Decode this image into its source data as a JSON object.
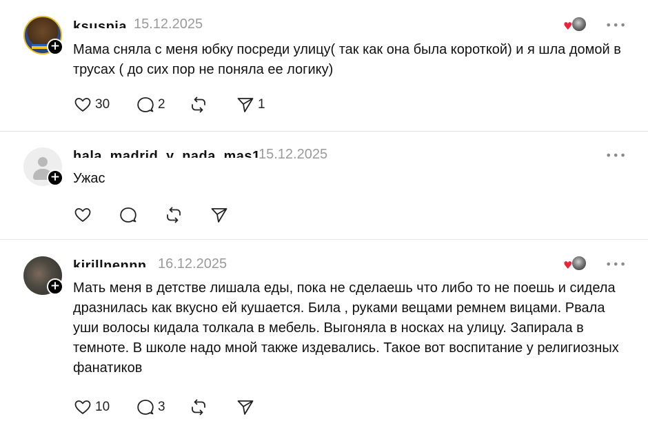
{
  "posts": [
    {
      "username": "ksuspia",
      "date": "15.12.2025",
      "text": "Мама сняла с меня юбку посреди улицу( так как она была короткой) и я шла домой в трусах ( до сих пор не поняла ее логику)",
      "likes": "30",
      "replies": "2",
      "reposts": "",
      "shares": "1"
    },
    {
      "username": "hala_madrid_y_nada_mas1",
      "date": "15.12.2025",
      "text": "Ужас",
      "likes": "",
      "replies": "",
      "reposts": "",
      "shares": ""
    },
    {
      "username": "kirillnennn",
      "date": "16.12.2025",
      "text": "Мать меня в детстве лишала еды, пока не сделаешь что либо то не поешь и сидела дразнилась как вкусно ей кушается. Била , руками вещами ремнем вицами. Рвала уши волосы кидала толкала в мебель. Выгоняла в носках на улицу. Запирала в темноте. В школе надо мной также издевались. Такое вот воспитание у религиозных фанатиков",
      "likes": "10",
      "replies": "3",
      "reposts": "",
      "shares": ""
    }
  ],
  "icons": {
    "more": "more-horizontal-icon",
    "follow": "plus-icon",
    "like": "heart-icon",
    "reply": "comment-icon",
    "repost": "repost-icon",
    "share": "send-icon",
    "author_liked": "heart-icon"
  },
  "colors": {
    "accent_heart": "#e8253b",
    "muted": "#9a9a9a",
    "divider": "#e3e3e3"
  }
}
